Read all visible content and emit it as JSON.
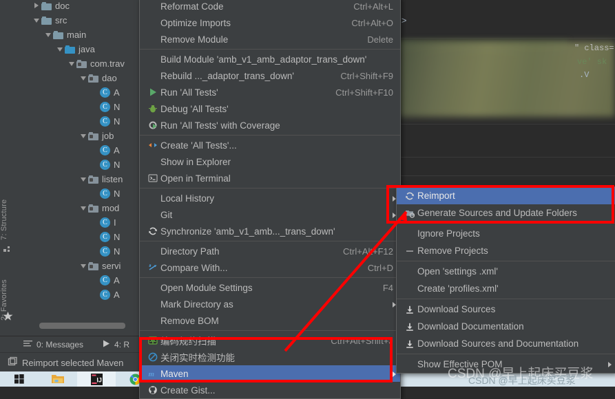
{
  "project_tree": {
    "items": [
      {
        "label": "doc",
        "indent": 1,
        "twisty": "right",
        "icon": "folder",
        "type": "folder"
      },
      {
        "label": "src",
        "indent": 1,
        "twisty": "down",
        "icon": "folder",
        "type": "folder"
      },
      {
        "label": "main",
        "indent": 2,
        "twisty": "down",
        "icon": "folder",
        "type": "folder"
      },
      {
        "label": "java",
        "indent": 3,
        "twisty": "down",
        "icon": "folder-source",
        "type": "folder"
      },
      {
        "label": "com.trav",
        "indent": 4,
        "twisty": "down",
        "icon": "folder-package",
        "type": "package"
      },
      {
        "label": "dao",
        "indent": 5,
        "twisty": "down",
        "icon": "folder-package",
        "type": "package"
      },
      {
        "label": "A",
        "indent": 6,
        "twisty": "none",
        "icon": "class-icon",
        "type": "class"
      },
      {
        "label": "N",
        "indent": 6,
        "twisty": "none",
        "icon": "class-icon",
        "type": "class"
      },
      {
        "label": "N",
        "indent": 6,
        "twisty": "none",
        "icon": "class-icon",
        "type": "class"
      },
      {
        "label": "job",
        "indent": 5,
        "twisty": "down",
        "icon": "folder-package",
        "type": "package"
      },
      {
        "label": "A",
        "indent": 6,
        "twisty": "none",
        "icon": "class-icon",
        "type": "class"
      },
      {
        "label": "N",
        "indent": 6,
        "twisty": "none",
        "icon": "class-icon",
        "type": "class"
      },
      {
        "label": "listen",
        "indent": 5,
        "twisty": "down",
        "icon": "folder-package",
        "type": "package"
      },
      {
        "label": "N",
        "indent": 6,
        "twisty": "none",
        "icon": "class-icon",
        "type": "class"
      },
      {
        "label": "mod",
        "indent": 5,
        "twisty": "down",
        "icon": "folder-package",
        "type": "package"
      },
      {
        "label": "I",
        "indent": 6,
        "twisty": "none",
        "icon": "class-icon",
        "type": "class"
      },
      {
        "label": "N",
        "indent": 6,
        "twisty": "none",
        "icon": "class-icon",
        "type": "class"
      },
      {
        "label": "N",
        "indent": 6,
        "twisty": "none",
        "icon": "class-icon",
        "type": "class"
      },
      {
        "label": "servi",
        "indent": 5,
        "twisty": "down",
        "icon": "folder-package",
        "type": "package"
      },
      {
        "label": "A",
        "indent": 6,
        "twisty": "none",
        "icon": "class-icon",
        "type": "class"
      },
      {
        "label": "A",
        "indent": 6,
        "twisty": "none",
        "icon": "class-icon",
        "type": "class"
      }
    ]
  },
  "left_toolbar": {
    "tabs": [
      {
        "label": "7: Structure",
        "underline": "7",
        "icon": "structure-icon"
      },
      {
        "label": "2: Favorites",
        "underline": "2",
        "icon": "star-icon"
      }
    ]
  },
  "editor": {
    "arrow_fragment": "->",
    "blurred": true
  },
  "context_menu": {
    "items": [
      {
        "label": "Reformat Code",
        "accel": "Ctrl+Alt+L",
        "icon": "",
        "clipped": true
      },
      {
        "label": "Optimize Imports",
        "accel": "Ctrl+Alt+O",
        "icon": ""
      },
      {
        "label": "Remove Module",
        "accel": "Delete",
        "icon": ""
      },
      {
        "sep": true
      },
      {
        "label": "Build Module 'amb_v1_amb_adaptor_trans_down'",
        "accel": "",
        "icon": ""
      },
      {
        "label": "Rebuild ..._adaptor_trans_down'",
        "accel": "Ctrl+Shift+F9",
        "icon": ""
      },
      {
        "label": "Run 'All Tests'",
        "accel": "Ctrl+Shift+F10",
        "icon": "run-icon"
      },
      {
        "label": "Debug 'All Tests'",
        "accel": "",
        "icon": "debug-icon"
      },
      {
        "label": "Run 'All Tests' with Coverage",
        "accel": "",
        "icon": "coverage-icon"
      },
      {
        "sep": true
      },
      {
        "label": "Create 'All Tests'...",
        "accel": "",
        "icon": "create-config-icon"
      },
      {
        "label": "Show in Explorer",
        "accel": "",
        "icon": ""
      },
      {
        "label": "Open in Terminal",
        "accel": "",
        "icon": "terminal-icon"
      },
      {
        "sep": true
      },
      {
        "label": "Local History",
        "accel": "",
        "icon": "",
        "submenu": true
      },
      {
        "label": "Git",
        "accel": "",
        "icon": "",
        "submenu": true
      },
      {
        "label": "Synchronize 'amb_v1_amb..._trans_down'",
        "accel": "",
        "icon": "sync-icon"
      },
      {
        "sep": true
      },
      {
        "label": "Directory Path",
        "accel": "Ctrl+Alt+F12",
        "icon": ""
      },
      {
        "label": "Compare With...",
        "accel": "Ctrl+D",
        "icon": "compare-icon"
      },
      {
        "sep": true
      },
      {
        "label": "Open Module Settings",
        "accel": "F4",
        "icon": ""
      },
      {
        "label": "Mark Directory as",
        "accel": "",
        "icon": "",
        "submenu": true
      },
      {
        "label": "Remove BOM",
        "accel": "",
        "icon": ""
      },
      {
        "sep": true
      },
      {
        "label": "编码规约扫描",
        "accel": "Ctrl+Alt+Shift+J",
        "icon": "scan-icon"
      },
      {
        "label": "关闭实时检测功能",
        "accel": "",
        "icon": "disable-icon"
      },
      {
        "label": "Maven",
        "accel": "",
        "icon": "maven-icon",
        "submenu": true,
        "selected": true
      },
      {
        "label": "Create Gist...",
        "accel": "",
        "icon": "github-icon",
        "clipped": true
      }
    ]
  },
  "maven_submenu": {
    "items": [
      {
        "label": "Reimport",
        "icon": "sync-icon",
        "selected": true
      },
      {
        "label": "Generate Sources and Update Folders",
        "icon": "generate-icon"
      },
      {
        "sep": true
      },
      {
        "label": "Ignore Projects",
        "icon": ""
      },
      {
        "label": "Remove Projects",
        "icon": "remove-icon"
      },
      {
        "sep": true
      },
      {
        "label": "Open 'settings .xml'",
        "icon": ""
      },
      {
        "label": "Create 'profiles.xml'",
        "icon": ""
      },
      {
        "sep": true
      },
      {
        "label": "Download Sources",
        "icon": "download-icon"
      },
      {
        "label": "Download Documentation",
        "icon": "download-icon"
      },
      {
        "label": "Download Sources and Documentation",
        "icon": "download-icon"
      },
      {
        "sep": true
      },
      {
        "label": "Show Effective POM",
        "icon": "",
        "submenu": true
      }
    ]
  },
  "toolwindow_bar": {
    "items": [
      {
        "label": "0: Messages",
        "underline": "0",
        "icon": "messages-icon"
      },
      {
        "label": "4: R",
        "underline": "4",
        "icon": "run-icon"
      }
    ]
  },
  "status_bar": {
    "text": "Reimport selected Maven",
    "icon": "window-icon"
  },
  "taskbar": {
    "items": [
      {
        "name": "start-button",
        "icon": "windows-icon"
      },
      {
        "name": "file-explorer",
        "icon": "folder-icon"
      },
      {
        "name": "intellij-idea",
        "icon": "idea-icon",
        "active": true
      },
      {
        "name": "google-chrome",
        "icon": "chrome-icon"
      },
      {
        "name": "app-five",
        "icon": "app-icon"
      }
    ]
  },
  "annotations": {
    "watermark_primary": "CSDN @早上起床买豆浆",
    "watermark_secondary": "CSDN @早上起床买豆浆",
    "highlight_color": "#FF0000",
    "selection_color": "#4B6EAF",
    "boxes": [
      {
        "name": "reimport-highlight-box"
      },
      {
        "name": "maven-highlight-box"
      }
    ],
    "arrow": {
      "name": "red-pointer-arrow",
      "from": "maven-item",
      "to": "generate-sources-item"
    }
  }
}
